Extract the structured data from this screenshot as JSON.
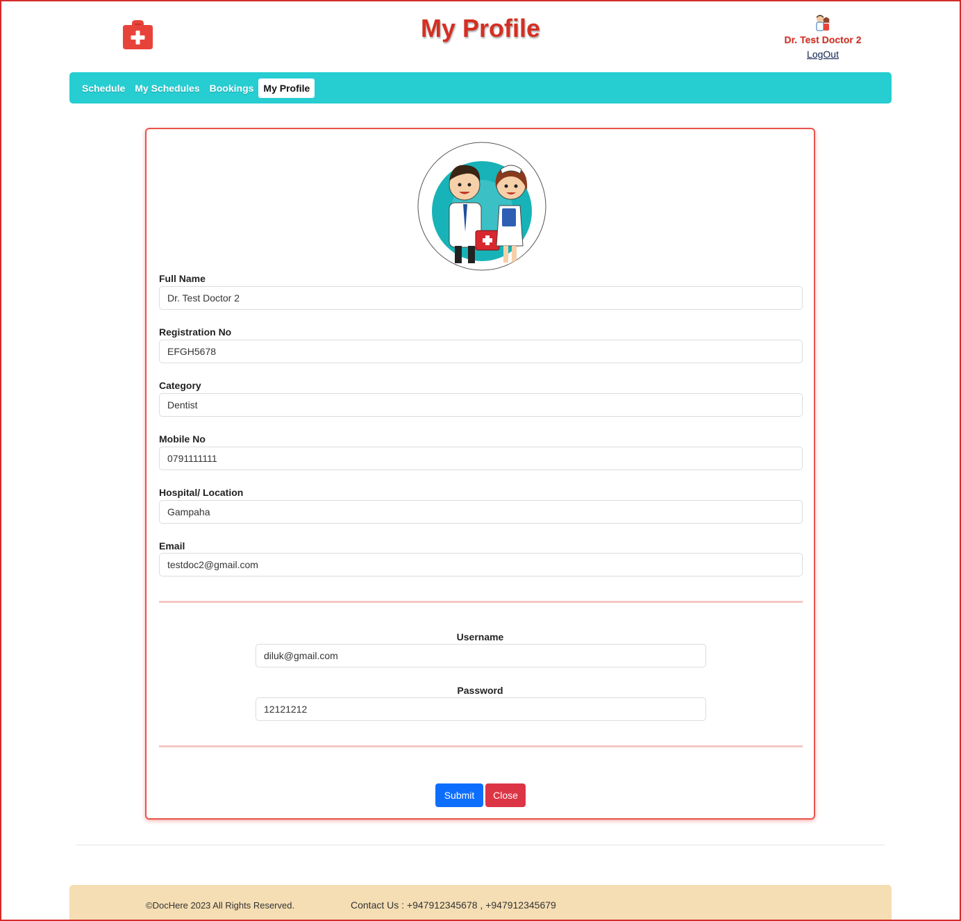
{
  "header": {
    "title": "My Profile",
    "user_name": "Dr. Test Doctor 2",
    "logout_label": "LogOut",
    "logo_icon": "medical-cross-icon",
    "brand_color": "#d52f23"
  },
  "nav": {
    "items": [
      {
        "label": "Schedule",
        "active": false
      },
      {
        "label": "My Schedules",
        "active": false
      },
      {
        "label": "Bookings",
        "active": false
      },
      {
        "label": "My Profile",
        "active": true
      }
    ],
    "color": "#26cdd1"
  },
  "profile": {
    "image_icon": "doctor-nurse-avatar-icon",
    "fields": [
      {
        "label": "Full Name",
        "value": "Dr. Test Doctor 2"
      },
      {
        "label": "Registration No",
        "value": "EFGH5678"
      },
      {
        "label": "Category",
        "value": "Dentist"
      },
      {
        "label": "Mobile No",
        "value": "0791111111"
      },
      {
        "label": "Hospital/ Location",
        "value": "Gampaha"
      },
      {
        "label": "Email",
        "value": "testdoc2@gmail.com"
      }
    ]
  },
  "credentials": {
    "username_label": "Username",
    "username_value": "diluk@gmail.com",
    "password_label": "Password",
    "password_value": "12121212"
  },
  "actions": {
    "submit_label": "Submit",
    "close_label": "Close"
  },
  "footer": {
    "copyright": "©DocHere 2023 All Rights Reserved.",
    "contact": "Contact Us : +947912345678 , +947912345679"
  }
}
